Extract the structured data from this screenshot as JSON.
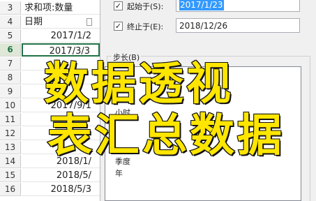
{
  "sheet": {
    "rows": [
      {
        "num": "3",
        "text": "求和项:数量",
        "kind": "txt"
      },
      {
        "num": "4",
        "text": "日期",
        "kind": "txt",
        "filter": true
      },
      {
        "num": "5",
        "text": "2017/1/2",
        "kind": "num"
      },
      {
        "num": "6",
        "text": "2017/3/3",
        "kind": "num",
        "active": true
      },
      {
        "num": "7",
        "text": "",
        "kind": "num"
      },
      {
        "num": "8",
        "text": "",
        "kind": "num"
      },
      {
        "num": "9",
        "text": "",
        "kind": "num"
      },
      {
        "num": "10",
        "text": "2017/9/1",
        "kind": "num"
      },
      {
        "num": "11",
        "text": "",
        "kind": "num"
      },
      {
        "num": "12",
        "text": "",
        "kind": "num"
      },
      {
        "num": "13",
        "text": "",
        "kind": "num"
      },
      {
        "num": "14",
        "text": "2018/1/",
        "kind": "num"
      },
      {
        "num": "15",
        "text": "2018/5/",
        "kind": "num"
      },
      {
        "num": "16",
        "text": "2018/5/3",
        "kind": "num"
      }
    ]
  },
  "dialog": {
    "start": {
      "label": "起始于(S):",
      "value": "2017/1/23",
      "checked": true
    },
    "end": {
      "label": "终止于(E):",
      "value": "2018/12/26",
      "checked": true
    },
    "step": {
      "label": "步长(B)",
      "items": [
        "小时",
        "季度",
        "年"
      ]
    }
  },
  "overlay": {
    "line1": "数据透视",
    "line2": "表汇总数据"
  }
}
